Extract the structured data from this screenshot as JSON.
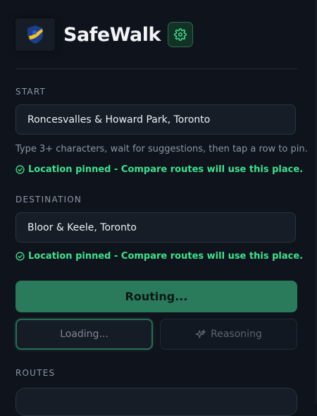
{
  "header": {
    "app_name": "SafeWalk",
    "logo_icon": "shield-map-logo",
    "settings_icon": "gear-icon"
  },
  "start": {
    "label": "START",
    "value": "Roncesvalles & Howard Park, Toronto",
    "hint": "Type 3+ characters, wait for suggestions, then tap a row to pin.",
    "status": "Location pinned - Compare routes will use this place."
  },
  "destination": {
    "label": "DESTINATION",
    "value": "Bloor & Keele, Toronto",
    "status": "Location pinned - Compare routes will use this place."
  },
  "actions": {
    "routing_label": "Routing...",
    "loading_label": "Loading...",
    "reasoning_label": "Reasoning"
  },
  "routes": {
    "label": "ROUTES"
  },
  "colors": {
    "background": "#0f141c",
    "accent": "#2a7a5c",
    "success": "#3ee08f"
  }
}
